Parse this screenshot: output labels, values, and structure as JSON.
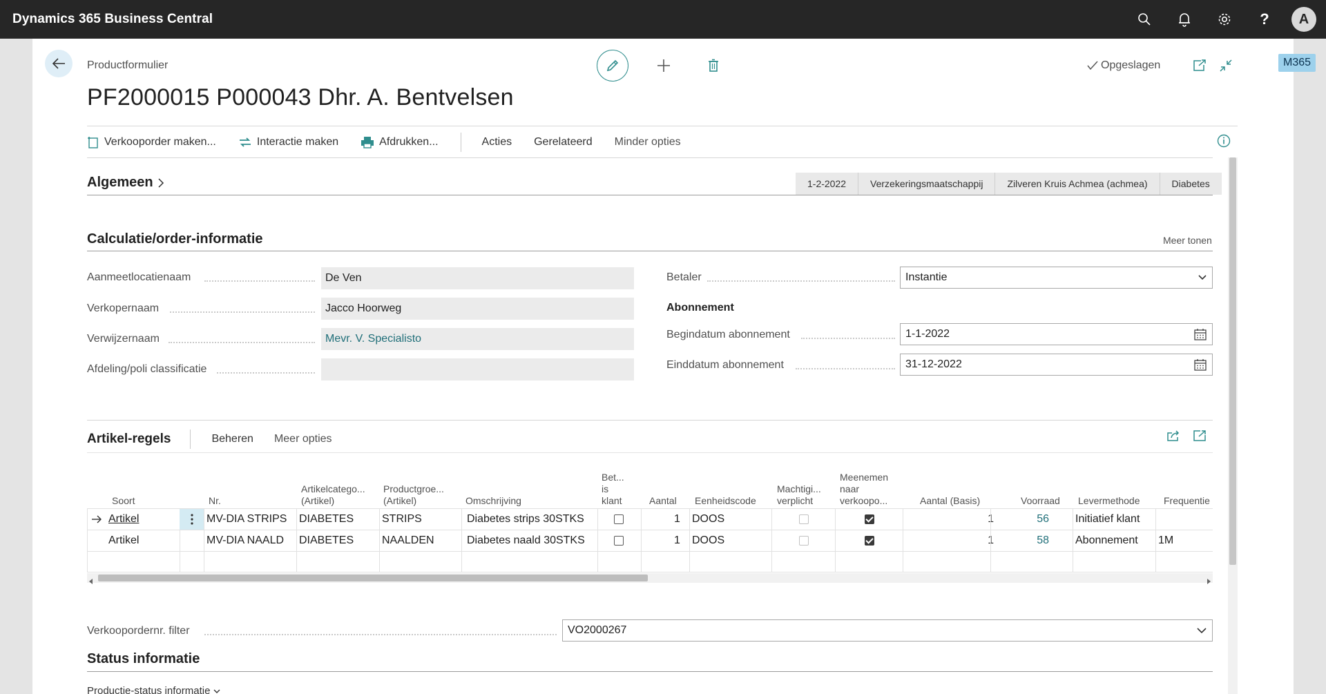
{
  "app": {
    "title": "Dynamics 365 Business Central",
    "avatar": "A",
    "badge": "M365"
  },
  "header": {
    "caption": "Productformulier",
    "title": "PF2000015 P000043 Dhr. A. Bentvelsen",
    "saved": "Opgeslagen"
  },
  "actions": {
    "create_sales_order": "Verkooporder maken...",
    "create_interaction": "Interactie maken",
    "print": "Afdrukken...",
    "actions": "Acties",
    "related": "Gerelateerd",
    "fewer_options": "Minder opties"
  },
  "general": {
    "title": "Algemeen",
    "tags": [
      "1-2-2022",
      "Verzekeringsmaatschappij",
      "Zilveren Kruis Achmea (achmea)",
      "Diabetes"
    ]
  },
  "calc": {
    "title": "Calculatie/order-informatie",
    "show_more": "Meer tonen",
    "fields": {
      "location_label": "Aanmeetlocatienaam",
      "location_value": "De Ven",
      "seller_label": "Verkopernaam",
      "seller_value": "Jacco Hoorweg",
      "referrer_label": "Verwijzernaam",
      "referrer_value": "Mevr. V. Specialisto",
      "dept_label": "Afdeling/poli classificatie",
      "dept_value": "",
      "payer_label": "Betaler",
      "payer_value": "Instantie",
      "subscription_head": "Abonnement",
      "start_label": "Begindatum abonnement",
      "start_value": "1-1-2022",
      "end_label": "Einddatum abonnement",
      "end_value": "31-12-2022"
    }
  },
  "lines": {
    "title": "Artikel-regels",
    "manage": "Beheren",
    "more_options": "Meer opties",
    "columns": {
      "soort": "Soort",
      "nr": "Nr.",
      "cat1": "Artikelcatego...",
      "cat2": "(Artikel)",
      "grp1": "Productgroe...",
      "grp2": "(Artikel)",
      "oms": "Omschrijving",
      "bet1": "Bet...",
      "bet2": "is",
      "bet3": "klant",
      "aantal": "Aantal",
      "eenheid": "Eenheidscode",
      "macht1": "Machtigi...",
      "macht2": "verplicht",
      "meen1": "Meenemen",
      "meen2": "naar",
      "meen3": "verkoopo...",
      "basis": "Aantal (Basis)",
      "voorraad": "Voorraad",
      "lever": "Levermethode",
      "freq": "Frequentie"
    },
    "rows": [
      {
        "soort": "Artikel",
        "nr": "MV-DIA STRIPS",
        "cat": "DIABETES",
        "grp": "STRIPS",
        "oms": "Diabetes strips  30STKS",
        "aantal": "1",
        "eenheid": "DOOS",
        "basis": "1",
        "voorraad": "56",
        "lever": "Initiatief klant",
        "freq": ""
      },
      {
        "soort": "Artikel",
        "nr": "MV-DIA NAALD",
        "cat": "DIABETES",
        "grp": "NAALDEN",
        "oms": "Diabetes naald  30STKS",
        "aantal": "1",
        "eenheid": "DOOS",
        "basis": "1",
        "voorraad": "58",
        "lever": "Abonnement",
        "freq": "1M"
      }
    ]
  },
  "filter": {
    "label": "Verkoopordernr. filter",
    "value": "VO2000267"
  },
  "status": {
    "title": "Status informatie",
    "sub": "Productie-status informatie"
  },
  "colors": {
    "accent": "#2f8d8d",
    "link": "#206f79",
    "topbar": "#262626"
  }
}
